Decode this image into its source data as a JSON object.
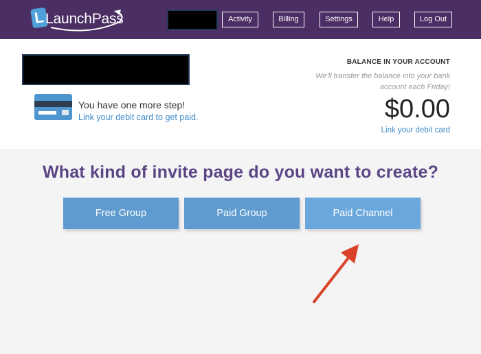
{
  "header": {
    "logo_text": "LaunchPass",
    "logo_letter": "L",
    "nav": [
      {
        "label": "Activity"
      },
      {
        "label": "Billing"
      },
      {
        "label": "Settings"
      },
      {
        "label": "Help"
      },
      {
        "label": "Log Out"
      }
    ]
  },
  "account": {
    "step_text": "You have one more step!",
    "step_link": "Link your debit card to get paid.",
    "balance_title": "BALANCE IN YOUR ACCOUNT",
    "balance_note": "We'll transfer the balance into your bank account each Friday!",
    "balance_amount": "$0.00",
    "balance_link": "Link your debit card"
  },
  "main": {
    "question": "What kind of invite page do you want to create?",
    "choices": [
      {
        "label": "Free Group"
      },
      {
        "label": "Paid Group"
      },
      {
        "label": "Paid Channel"
      }
    ]
  },
  "colors": {
    "topbar": "#4b2e63",
    "accent_blue": "#5f9bcf",
    "question_purple": "#5b4585",
    "arrow_red": "#d9412a"
  },
  "icons": {
    "card": "credit-card-icon",
    "arrow": "annotation-arrow-icon"
  }
}
